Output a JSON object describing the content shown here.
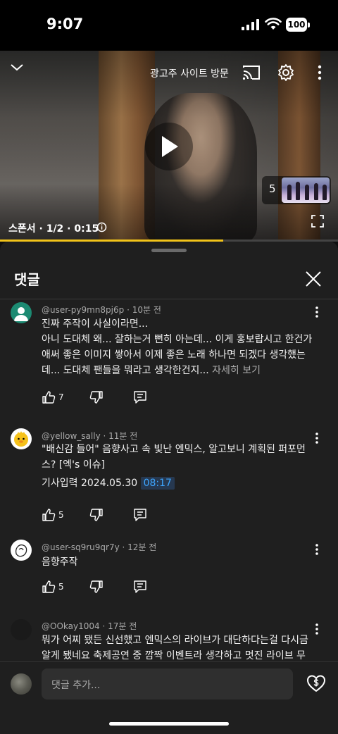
{
  "status_bar": {
    "time": "9:07",
    "battery": "100"
  },
  "video": {
    "ad_site_label": "광고주 사이트 방문",
    "ad_info": "스폰서 · 1/2 · 0:15",
    "queue_count": "5",
    "progress": 0.66,
    "progress_color": "#f2c41a"
  },
  "comments_panel": {
    "title": "댓글",
    "comments": [
      {
        "author": "@user-py9mn8pj6p",
        "age": "10분 전",
        "lines": [
          "진짜 주작이 사실이라면...",
          "아니 도대체 왜... 잘하는거 뻔히 아는데... 이게 홍보랍시고 한건가 애써 좋은 이미지 쌓아서 이제 좋은 노래 하나면 되겠다 생각했는데... 도대체 팬들을 뭐라고 생각한건지..."
        ],
        "read_more": "자세히 보기",
        "likes": "7",
        "avatar_color": "#1c8a72"
      },
      {
        "author": "@yellow_sally",
        "age": "11분 전",
        "lines": [
          "\"배신감 들어\" 음향사고 속 빛난 엔믹스, 알고보니 계획된 퍼포먼스? [엑's 이슈]"
        ],
        "press_label": "기사입력 2024.05.30",
        "timestamp": "08:17",
        "likes": "5"
      },
      {
        "author": "@user-sq9ru9qr7y",
        "age": "12분 전",
        "lines": [
          "음향주작"
        ],
        "likes": "5"
      },
      {
        "author": "@OOkay1004",
        "age": "17분 전",
        "lines": [
          "뭐가 어찌 됐든 신선했고 엔믹스의 라이브가 대단하다는걸 다시금 알게 됐네요 축제공연 중 깜짝 이벤트라 생각하고 멋진 라이브 무대"
        ]
      }
    ],
    "add_comment_placeholder": "댓글 추가..."
  },
  "colors": {
    "accent_link": "#3ea6ff",
    "background": "#0f0f0f",
    "sheet": "#1f1f1f"
  }
}
